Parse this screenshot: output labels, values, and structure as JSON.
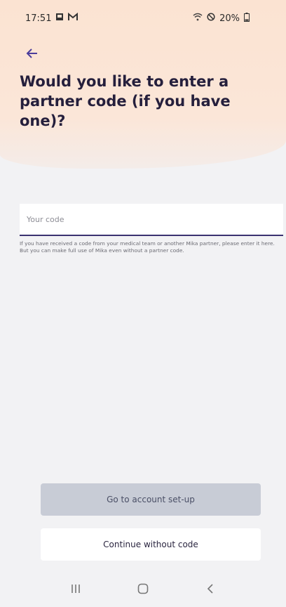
{
  "status_bar": {
    "time": "17:51",
    "battery": "20%"
  },
  "header": {
    "title": "Would you like to enter a partner code (if you have one)?"
  },
  "form": {
    "placeholder": "Your code",
    "help_text": "If you have received a code from your medical team or another Mika partner, please enter it here. But you can make full use of Mika even without a partner code."
  },
  "buttons": {
    "primary": "Go to account set-up",
    "secondary": "Continue without code"
  },
  "colors": {
    "accent": "#3a3270",
    "peach": "#fbe3d2",
    "disabled_button": "#c8ccd6"
  },
  "icons": [
    "back-arrow-icon",
    "gallery-icon",
    "gmail-icon",
    "wifi-icon",
    "do-not-disturb-icon",
    "battery-icon",
    "recent-apps-icon",
    "home-icon",
    "back-nav-icon"
  ]
}
